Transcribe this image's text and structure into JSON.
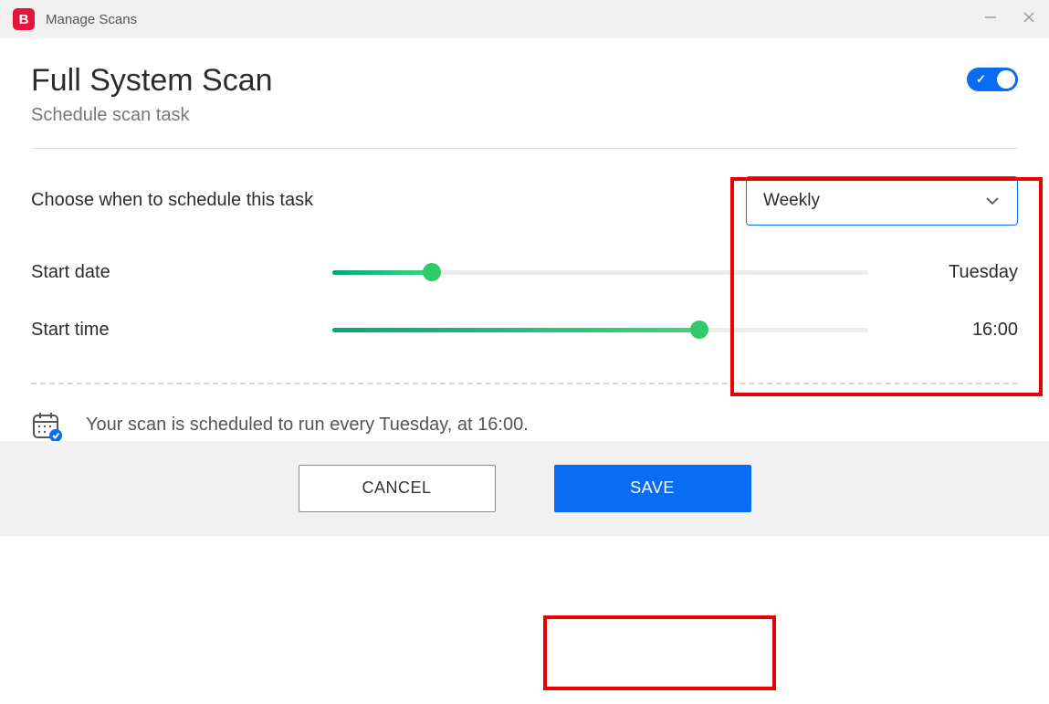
{
  "window": {
    "logo_letter": "B",
    "title": "Manage Scans"
  },
  "header": {
    "title": "Full System Scan",
    "subtitle": "Schedule scan task",
    "toggle_on": true
  },
  "schedule": {
    "choose_label": "Choose when to schedule this task",
    "frequency_selected": "Weekly",
    "start_date_label": "Start date",
    "start_date_value": "Tuesday",
    "start_date_fraction": 0.185,
    "start_time_label": "Start time",
    "start_time_value": "16:00",
    "start_time_fraction": 0.685
  },
  "summary": {
    "text": "Your scan is scheduled to run every Tuesday, at 16:00."
  },
  "footer": {
    "cancel": "CANCEL",
    "save": "SAVE"
  },
  "colors": {
    "accent": "#0a6cf1",
    "brand": "#e5143c",
    "slider_start": "#00a97a",
    "slider_end": "#41d483",
    "annotation": "#e90000"
  }
}
